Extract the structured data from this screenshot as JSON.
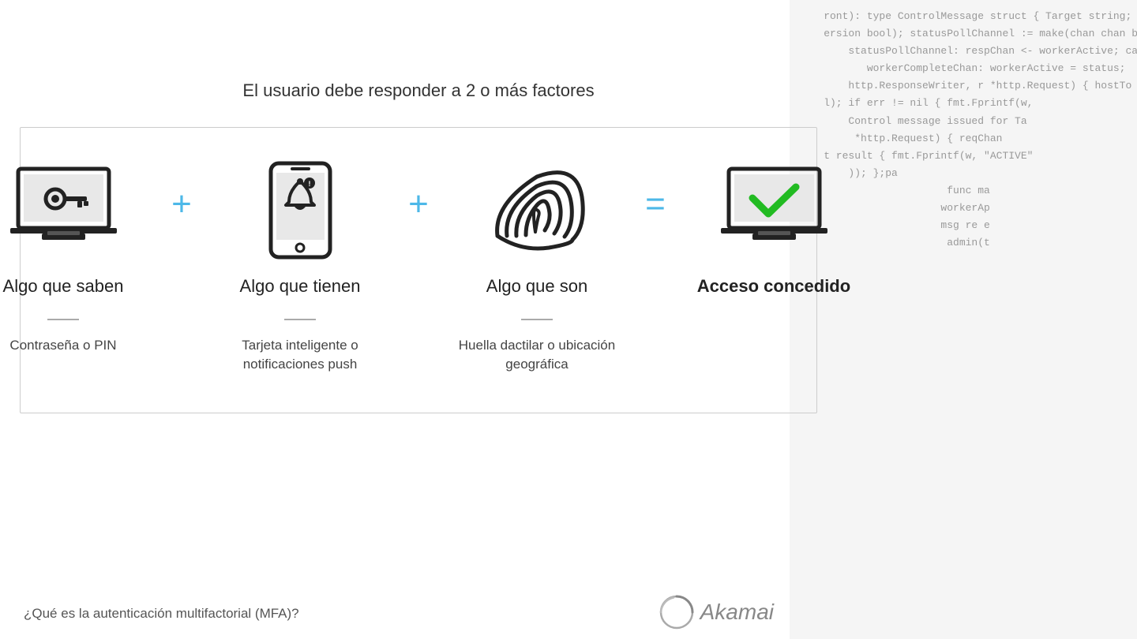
{
  "code_bg": {
    "lines": [
      "ront): type ControlMessage struct { Target string; Con",
      "ersion bool); statusPollChannel := make(chan chan bool); v",
      "   statusPollChannel: respChan <- workerActive; case",
      "      workerCompleteChan: workerActive = status;",
      "   http.ResponseWriter, r *http.Request) { hostTo",
      "ol); if err != nil { fmt.Fprintf(w,",
      "    Control message issued for Ta",
      "     *http.Request) { reqChan",
      "st result { fmt.Fprintf(w, \"ACTIVE\"",
      "    )); };pa",
      "                    func ma",
      "                   workerAp",
      "                   msg re e",
      "                    admin(t"
    ]
  },
  "header": {
    "label": "El usuario debe responder a 2 o\nmás factores"
  },
  "factors": [
    {
      "icon_type": "laptop-key",
      "title": "Algo que saben",
      "subtitle": "Contraseña\no PIN"
    },
    {
      "icon_type": "phone-bell",
      "title": "Algo que tienen",
      "subtitle": "Tarjeta inteligente o\nnotificaciones push"
    },
    {
      "icon_type": "fingerprint",
      "title": "Algo que son",
      "subtitle": "Huella dactilar o\nubicación geográfica"
    }
  ],
  "result": {
    "icon_type": "laptop-check",
    "title": "Acceso concedido"
  },
  "operators": {
    "plus": "+",
    "equals": "="
  },
  "bottom": {
    "question": "¿Qué es la autenticación multifactorial (MFA)?"
  },
  "brand": {
    "name": "Akamai"
  }
}
